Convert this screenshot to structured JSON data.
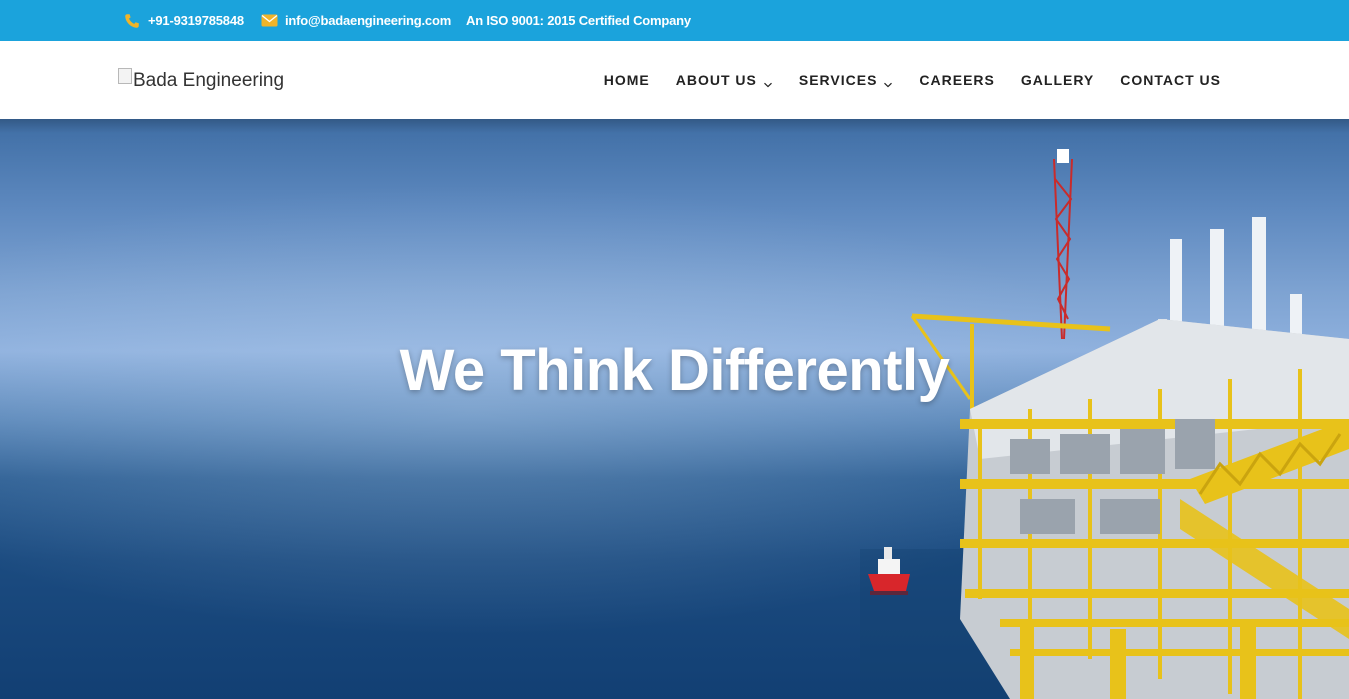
{
  "topbar": {
    "phone": "+91-9319785848",
    "email": "info@badaengineering.com",
    "certification": "An ISO 9001: 2015 Certified Company"
  },
  "header": {
    "logo_alt": "Bada Engineering",
    "nav": [
      {
        "label": "HOME"
      },
      {
        "label": "ABOUT US"
      },
      {
        "label": "SERVICES"
      },
      {
        "label": "CAREERS"
      },
      {
        "label": "GALLERY"
      },
      {
        "label": "CONTACT US"
      }
    ]
  },
  "hero": {
    "title": "We Think Differently"
  },
  "colors": {
    "topbar": "#1ba3dc",
    "icon_accent": "#f0b429",
    "nav_text": "#222222",
    "rig_yellow": "#e8c21a"
  },
  "icons": {
    "phone": "phone-icon",
    "email": "envelope-icon",
    "dropdown": "chevron-down-icon"
  }
}
